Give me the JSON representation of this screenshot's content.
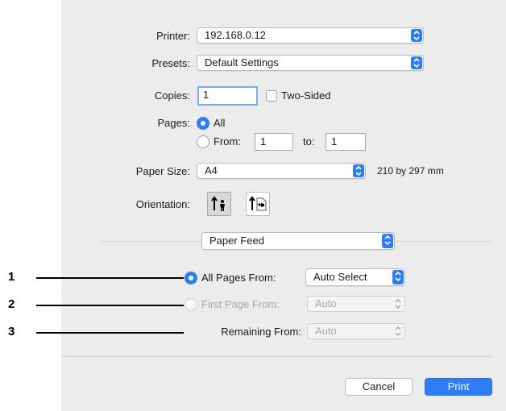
{
  "printer": {
    "label": "Printer:",
    "value": "192.168.0.12"
  },
  "presets": {
    "label": "Presets:",
    "value": "Default Settings"
  },
  "copies": {
    "label": "Copies:",
    "value": "1",
    "two_sided_label": "Two-Sided"
  },
  "pages": {
    "label": "Pages:",
    "all_label": "All",
    "from_label": "From:",
    "from_value": "1",
    "to_label": "to:",
    "to_value": "1"
  },
  "paper_size": {
    "label": "Paper Size:",
    "value": "A4",
    "dimensions": "210 by 297 mm"
  },
  "orientation": {
    "label": "Orientation:",
    "options": [
      "portrait",
      "landscape"
    ],
    "selected": "portrait"
  },
  "section_popup": {
    "value": "Paper Feed"
  },
  "paper_feed": {
    "all_pages_label": "All Pages From:",
    "all_pages_value": "Auto Select",
    "first_page_label": "First Page From:",
    "first_page_value": "Auto",
    "remaining_label": "Remaining From:",
    "remaining_value": "Auto"
  },
  "callouts": [
    "1",
    "2",
    "3"
  ],
  "buttons": {
    "cancel": "Cancel",
    "print": "Print"
  },
  "colors": {
    "accent": "#2e7cf6",
    "dialog_bg": "#ececec"
  }
}
